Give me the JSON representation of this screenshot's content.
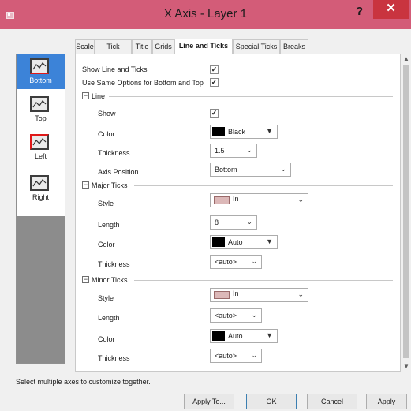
{
  "window": {
    "title": "X Axis - Layer 1",
    "help_label": "?",
    "close_label": "✕"
  },
  "tabs": [
    {
      "label": "Scale"
    },
    {
      "label": "Tick Labels"
    },
    {
      "label": "Title"
    },
    {
      "label": "Grids"
    },
    {
      "label": "Line and Ticks",
      "active": true
    },
    {
      "label": "Special Ticks"
    },
    {
      "label": "Breaks"
    }
  ],
  "sidebar": {
    "items": [
      {
        "label": "Bottom",
        "selected": true,
        "icon": "axis-bottom-icon"
      },
      {
        "label": "Top",
        "selected": false,
        "icon": "axis-top-icon"
      },
      {
        "label": "Left",
        "selected": false,
        "icon": "axis-left-icon"
      },
      {
        "label": "Right",
        "selected": false,
        "icon": "axis-right-icon"
      }
    ]
  },
  "options": {
    "show_line_and_ticks": {
      "label": "Show Line and Ticks",
      "checked": true
    },
    "same_options": {
      "label": "Use Same Options for Bottom and Top",
      "checked": true
    }
  },
  "line": {
    "group_label": "Line",
    "show_label": "Show",
    "show_checked": true,
    "color_label": "Color",
    "color_value": "Black",
    "thickness_label": "Thickness",
    "thickness_value": "1.5",
    "axis_position_label": "Axis Position",
    "axis_position_value": "Bottom"
  },
  "major_ticks": {
    "group_label": "Major Ticks",
    "style_label": "Style",
    "style_value": "In",
    "length_label": "Length",
    "length_value": "8",
    "color_label": "Color",
    "color_value": "Auto",
    "thickness_label": "Thickness",
    "thickness_value": "<auto>"
  },
  "minor_ticks": {
    "group_label": "Minor Ticks",
    "style_label": "Style",
    "style_value": "In",
    "length_label": "Length",
    "length_value": "<auto>",
    "color_label": "Color",
    "color_value": "Auto",
    "thickness_label": "Thickness",
    "thickness_value": "<auto>"
  },
  "footer": {
    "hint": "Select multiple axes to customize together.",
    "apply_to": "Apply To...",
    "ok": "OK",
    "cancel": "Cancel",
    "apply": "Apply"
  },
  "colors": {
    "titlebar": "#d35c78",
    "close": "#c9343f",
    "selection": "#3c83d8"
  }
}
